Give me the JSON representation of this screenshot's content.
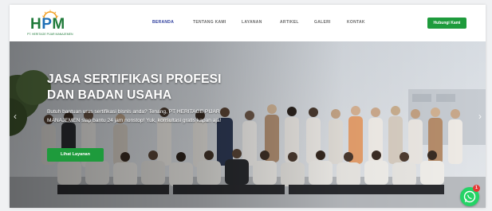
{
  "header": {
    "logo": {
      "wordmark": "HPM",
      "tagline": "PT. HERITAGE PIJAR MANAJEMEN"
    },
    "nav": [
      {
        "label": "BERANDA",
        "active": true
      },
      {
        "label": "TENTANG KAMI",
        "active": false
      },
      {
        "label": "LAYANAN",
        "active": false
      },
      {
        "label": "ARTIKEL",
        "active": false
      },
      {
        "label": "GALERI",
        "active": false
      },
      {
        "label": "KONTAK",
        "active": false
      }
    ],
    "cta_label": "Hubungi Kami"
  },
  "hero": {
    "title_line1": "JASA SERTIFIKASI PROFESI",
    "title_line2": "DAN BADAN USAHA",
    "description": "Butuh bantuan urus sertifikasi bisnis anda? Tenang, PT HERITAGE PIJAR MANAJEMEN siap bantu 24 jam nonstop! Yuk, konsultasi gratis kapan aja!",
    "button_label": "Lihat Layanan",
    "prev_icon": "chevron-left-icon",
    "next_icon": "chevron-right-icon"
  },
  "whatsapp": {
    "icon": "whatsapp-icon",
    "badge_count": "1"
  },
  "colors": {
    "accent_green": "#1e9b3c",
    "nav_active": "#2f3f9e",
    "nav_text": "#6b6b6b",
    "whatsapp_green": "#25d366",
    "badge_red": "#e53935"
  }
}
